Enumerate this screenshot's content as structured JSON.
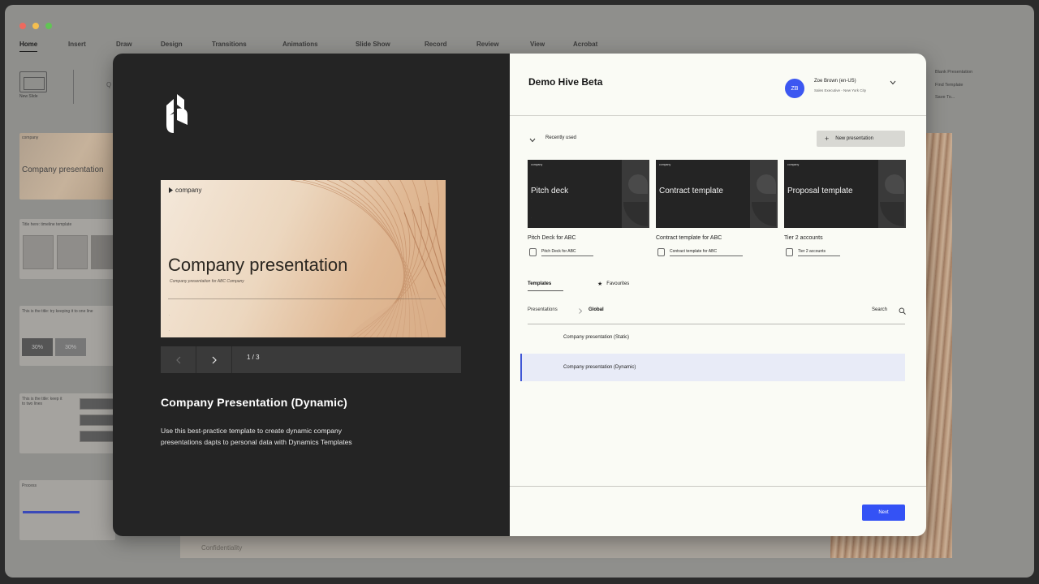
{
  "app": {
    "ribbon_tabs": [
      "Home",
      "Insert",
      "Draw",
      "Design",
      "Transitions",
      "Animations",
      "Slide Show",
      "Record",
      "Review",
      "View",
      "Acrobat"
    ],
    "new_slide_label": "New Slide",
    "right_actions": [
      "Blank Presentation",
      "Find Template",
      "Save To..."
    ],
    "thumbnails": [
      {
        "title": "Company presentation"
      },
      {
        "title": "Title here: timeline template"
      },
      {
        "title": "This is the title: try keeping it to one line",
        "stat_a": "30%",
        "stat_b": "30%"
      },
      {
        "title": "This is the title: keep it to two lines"
      },
      {
        "title": "Process"
      }
    ],
    "slide_footer": "Confidentiality",
    "traffic_colors": [
      "#ed6a5e",
      "#f4bf4f",
      "#61c554"
    ]
  },
  "preview": {
    "logo": "hive-logo-icon",
    "brand": "company",
    "title": "Company presentation",
    "subtitle": "Company presentation for ABC Company",
    "page_indicator": "1 / 3",
    "template_title": "Company Presentation (Dynamic)",
    "template_description": "Use this best-practice template to create dynamic company presentations dapts to personal data with Dynamics Templates"
  },
  "panel": {
    "title": "Demo Hive Beta",
    "user": {
      "initials": "ZB",
      "name": "Zoe Brown (en-US)",
      "role": "Sales Executive - New York City"
    },
    "recently_used_label": "Recently used",
    "new_presentation_label": "New presentation",
    "recent": [
      {
        "card_brand": "company",
        "card_title": "Pitch deck",
        "caption": "Pitch Deck for ABC",
        "file": "Pitch Deck for ABC"
      },
      {
        "card_brand": "company",
        "card_title": "Contract template",
        "caption": "Contract template for ABC",
        "file": "Contract template for ABC"
      },
      {
        "card_brand": "company",
        "card_title": "Proposal template",
        "caption": "Tier 2 accounts",
        "file": "Tier 2 accounts"
      }
    ],
    "tabs": {
      "templates": "Templates",
      "favourites": "Favourites"
    },
    "breadcrumb": {
      "root": "Presentations",
      "current": "Global"
    },
    "search_label": "Search",
    "list": [
      {
        "name": "Company presentation (Static)",
        "selected": false
      },
      {
        "name": "Company presentation (Dynamic)",
        "selected": true
      }
    ],
    "next_label": "Next"
  },
  "colors": {
    "accent": "#3452f5",
    "selection": "#e8ebf7",
    "dark": "#242424",
    "panel": "#fafbf5"
  }
}
